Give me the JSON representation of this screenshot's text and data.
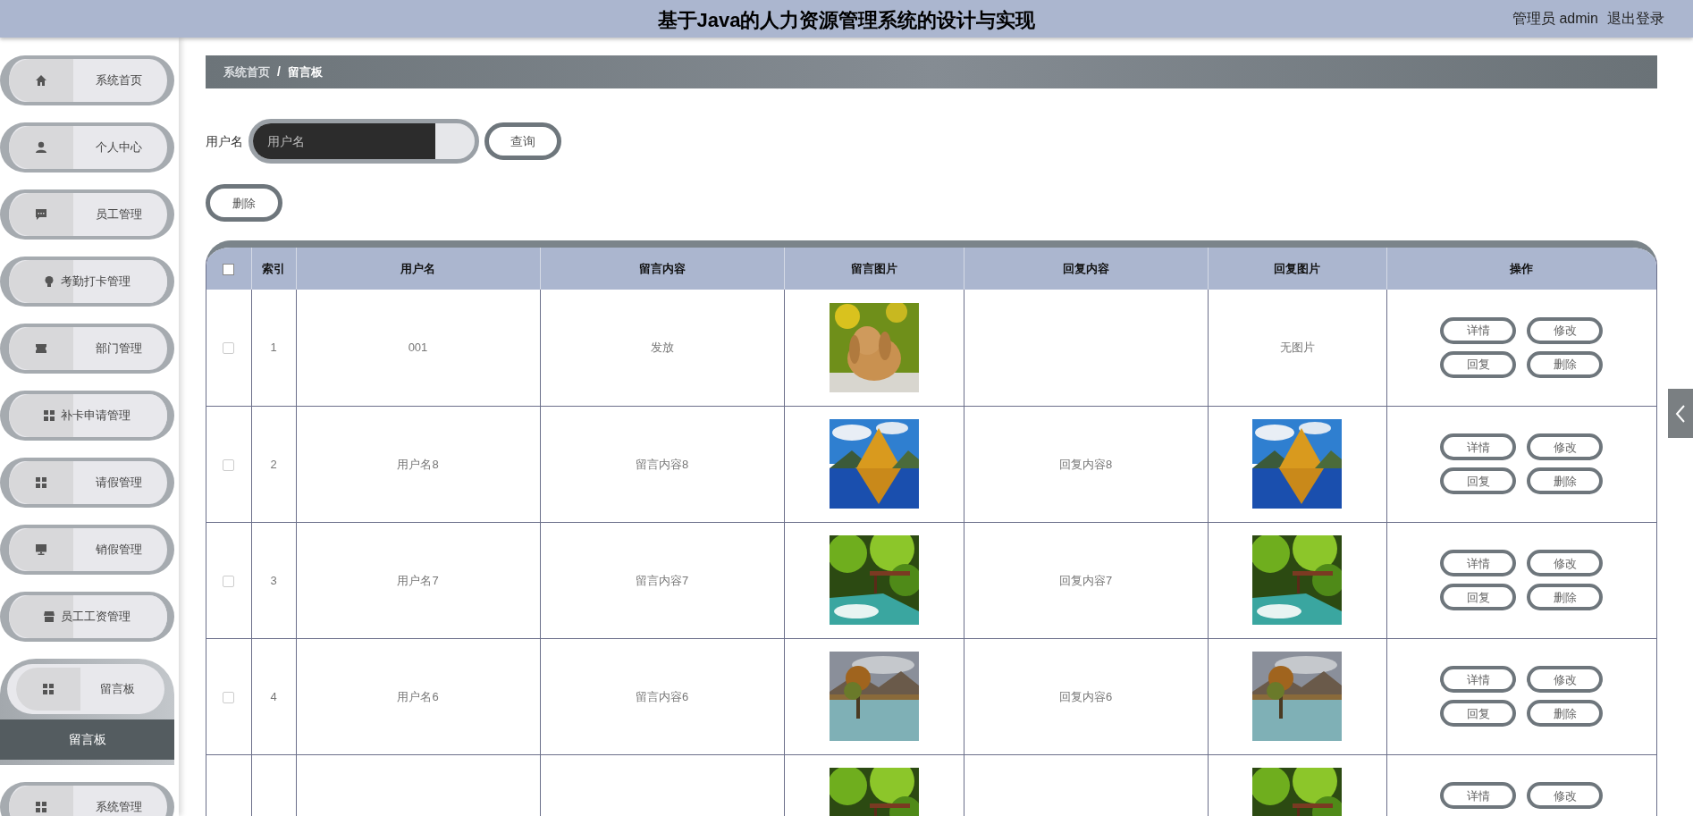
{
  "header": {
    "title": "基于Java的人力资源管理系统的设计与实现",
    "user": "管理员 admin",
    "logout": "退出登录"
  },
  "sidebar": {
    "items": [
      {
        "label": "系统首页",
        "expanded": false
      },
      {
        "label": "个人中心",
        "expanded": false
      },
      {
        "label": "员工管理",
        "expanded": false
      },
      {
        "label": "考勤打卡管理",
        "expanded": false
      },
      {
        "label": "部门管理",
        "expanded": false
      },
      {
        "label": "补卡申请管理",
        "expanded": false
      },
      {
        "label": "请假管理",
        "expanded": false
      },
      {
        "label": "销假管理",
        "expanded": false
      },
      {
        "label": "员工工资管理",
        "expanded": false
      },
      {
        "label": "留言板",
        "expanded": true,
        "children": [
          {
            "label": "留言板",
            "selected": true
          }
        ]
      },
      {
        "label": "系统管理",
        "expanded": false
      }
    ]
  },
  "breadcrumb": [
    "系统首页",
    "/",
    "留言板"
  ],
  "search": {
    "label": "用户名",
    "placeholder": "用户名",
    "button": "查询"
  },
  "delete_button": "删除",
  "table": {
    "columns": [
      "索引",
      "用户名",
      "留言内容",
      "留言图片",
      "回复内容",
      "回复图片",
      "操作"
    ],
    "select_all_checked": false,
    "rows": [
      {
        "checked": false,
        "index": "1",
        "username": "001",
        "content": "发放",
        "image": {
          "kind": "picture"
        },
        "reply_image": {
          "kind": "none",
          "text": "无图片"
        },
        "actions": [
          "详情",
          "修改",
          "回复",
          "删除"
        ]
      },
      {
        "checked": false,
        "index": "2",
        "username": "用户名8",
        "content": "留言内容8",
        "image": {
          "kind": "picture"
        },
        "reply": "回复内容8",
        "reply_image": {
          "kind": "picture"
        },
        "actions": [
          "详情",
          "修改",
          "回复",
          "删除"
        ]
      },
      {
        "checked": false,
        "index": "3",
        "username": "用户名7",
        "content": "留言内容7",
        "image": {
          "kind": "picture"
        },
        "reply": "回复内容7",
        "reply_image": {
          "kind": "picture"
        },
        "actions": [
          "详情",
          "修改",
          "回复",
          "删除"
        ]
      },
      {
        "checked": false,
        "index": "4",
        "username": "用户名6",
        "content": "留言内容6",
        "image": {
          "kind": "picture"
        },
        "reply": "回复内容6",
        "reply_image": {
          "kind": "picture"
        },
        "actions": [
          "详情",
          "修改",
          "回复",
          "删除"
        ]
      },
      {
        "image": {
          "kind": "picture"
        },
        "reply_image": {
          "kind": "picture"
        },
        "actions": [
          "详情",
          "修改"
        ]
      }
    ]
  }
}
